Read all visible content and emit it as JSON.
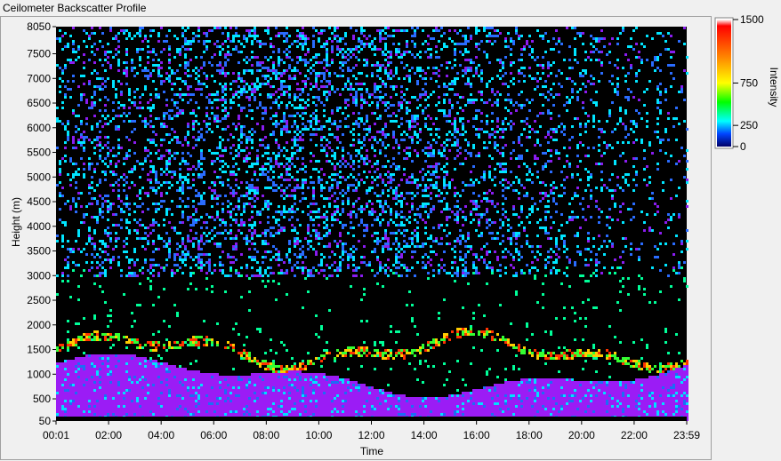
{
  "window": {
    "title": "Ceilometer Backscatter Profile"
  },
  "chart_data": {
    "type": "heatmap",
    "title": "Ceilometer Backscatter Profile",
    "xlabel": "Time",
    "ylabel": "Height (m)",
    "x_ticks": [
      "00:01",
      "02:00",
      "04:00",
      "06:00",
      "08:00",
      "10:00",
      "12:00",
      "14:00",
      "16:00",
      "18:00",
      "20:00",
      "22:00",
      "23:59"
    ],
    "x_range": [
      "00:01",
      "23:59"
    ],
    "y_ticks": [
      50,
      500,
      1000,
      1500,
      2000,
      2500,
      3000,
      3500,
      4000,
      4500,
      5000,
      5500,
      6000,
      6500,
      7000,
      7500,
      8050
    ],
    "ylim": [
      50,
      8050
    ],
    "colorbar": {
      "label": "Intensity",
      "ticks": [
        0,
        250,
        750,
        1500
      ],
      "range": [
        0,
        1500
      ],
      "colors": [
        "#000000",
        "#0033ff",
        "#00ffff",
        "#00ff00",
        "#ffff00",
        "#ff8800",
        "#ff0000",
        "#ffffff"
      ]
    },
    "background_color": "#000000",
    "features": [
      {
        "name": "boundary-layer",
        "description_color": "#9900ff",
        "height_range": [
          50,
          1500
        ]
      },
      {
        "name": "cloud-layer",
        "description_color": "#ff4400",
        "height_range": [
          1000,
          2000
        ]
      },
      {
        "name": "noise",
        "description_color": "#00ffff",
        "height_range": [
          3000,
          8050
        ]
      }
    ]
  }
}
